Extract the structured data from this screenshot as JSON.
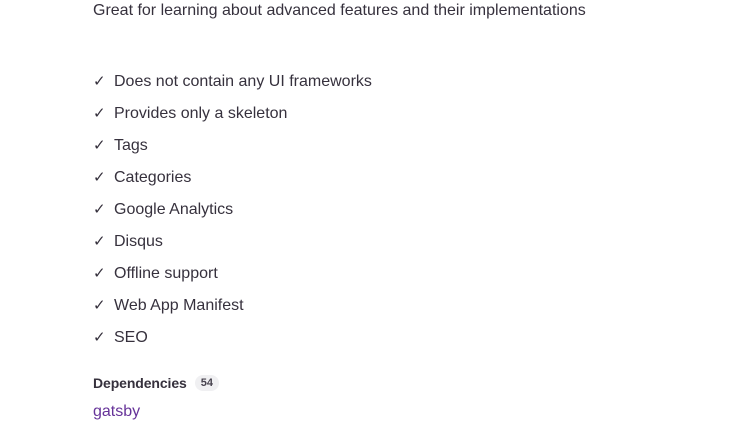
{
  "intro_text": "Great for learning about advanced features and their implementations",
  "features": [
    "Does not contain any UI frameworks",
    "Provides only a skeleton",
    "Tags",
    "Categories",
    "Google Analytics",
    "Disqus",
    "Offline support",
    "Web App Manifest",
    "SEO"
  ],
  "check_glyph": "✓",
  "dependencies": {
    "title": "Dependencies",
    "count": "54",
    "first_item": "gatsby"
  },
  "colors": {
    "text": "#36313d",
    "link": "#663399",
    "badge_bg": "#f0f0f2"
  }
}
